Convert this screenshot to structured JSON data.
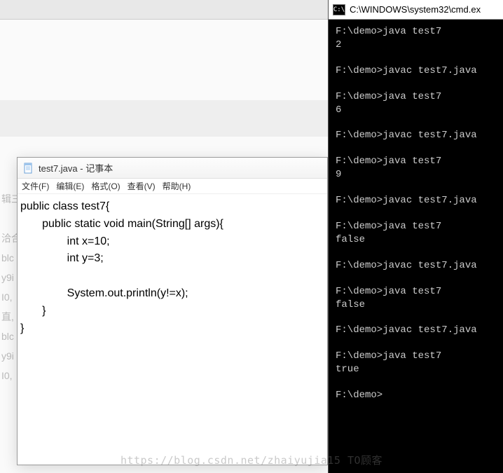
{
  "background": {
    "fragments": [
      "辑三",
      "",
      "洽合",
      "blc",
      "y9i",
      "I0,",
      "直,",
      "blc",
      "y9i",
      "I0,"
    ]
  },
  "notepad": {
    "title": "test7.java - 记事本",
    "menu": {
      "file": "文件(F)",
      "edit": "编辑(E)",
      "format": "格式(O)",
      "view": "查看(V)",
      "help": "帮助(H)"
    },
    "code_lines": [
      "public class test7{",
      "       public static void main(String[] args){",
      "               int x=10;",
      "               int y=3;",
      "",
      "               System.out.println(y!=x);",
      "       }",
      "}"
    ]
  },
  "cmd": {
    "title": "C:\\WINDOWS\\system32\\cmd.ex",
    "icon_text": "C:\\",
    "lines": [
      "F:\\demo>java test7",
      "2",
      "",
      "F:\\demo>javac test7.java",
      "",
      "F:\\demo>java test7",
      "6",
      "",
      "F:\\demo>javac test7.java",
      "",
      "F:\\demo>java test7",
      "9",
      "",
      "F:\\demo>javac test7.java",
      "",
      "F:\\demo>java test7",
      "false",
      "",
      "F:\\demo>javac test7.java",
      "",
      "F:\\demo>java test7",
      "false",
      "",
      "F:\\demo>javac test7.java",
      "",
      "F:\\demo>java test7",
      "true",
      "",
      "F:\\demo>"
    ]
  },
  "watermark": "https://blog.csdn.net/zhaiyujia15   TO顾客"
}
